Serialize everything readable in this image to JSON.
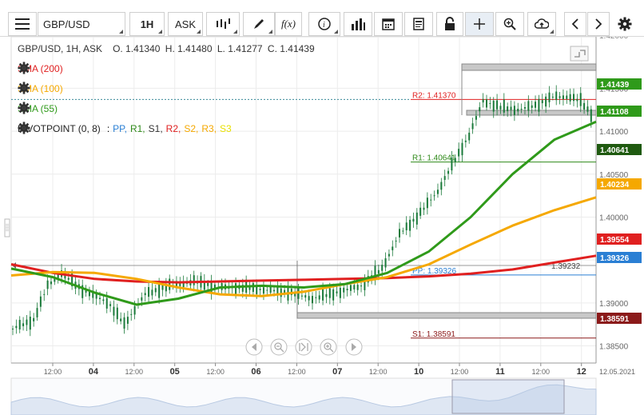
{
  "toolbar": {
    "symbol": "GBP/USD",
    "timeframe": "1H",
    "price_type": "ASK",
    "fx_label": "f(x)"
  },
  "header": {
    "instrument": "GBP/USD, 1H, ASK",
    "open": "O. 1.41340",
    "high": "H. 1.41480",
    "low": "L. 1.41277",
    "close": "C. 1.41439"
  },
  "indicators": [
    {
      "label": "SMA (200)",
      "color": "#e02020"
    },
    {
      "label": "SMA (100)",
      "color": "#f5a800"
    },
    {
      "label": "SMA (55)",
      "color": "#2f9a1a"
    }
  ],
  "pivot": {
    "label": "PIVOTPOINT (0, 8)",
    "sep": ":",
    "items": [
      {
        "label": "PP,",
        "color": "#2a7fd4"
      },
      {
        "label": "R1,",
        "color": "#2f8a1a"
      },
      {
        "label": "S1,",
        "color": "#333333"
      },
      {
        "label": "R2,",
        "color": "#e02020"
      },
      {
        "label": "S2,",
        "color": "#f5a800"
      },
      {
        "label": "R3,",
        "color": "#f5a800"
      },
      {
        "label": "S3",
        "color": "#e8e000"
      }
    ]
  },
  "price_axis": {
    "ticks": [
      "1.41500",
      "1.41000",
      "1.40500",
      "1.40000",
      "1.39500",
      "1.39000",
      "1.38500"
    ],
    "top_partial": "1.42000",
    "badges": [
      {
        "value": "1.41439",
        "color": "#2f9a1a"
      },
      {
        "value": "1.41108",
        "color": "#2f9a1a"
      },
      {
        "value": "1.40641",
        "color": "#1f5a10"
      },
      {
        "value": "1.40234",
        "color": "#f5a800"
      },
      {
        "value": "1.39554",
        "color": "#e02020"
      },
      {
        "value": "1.39326",
        "color": "#2a7fd4"
      },
      {
        "value": "1.38591",
        "color": "#8b1a1a"
      }
    ],
    "cursor_value": "1.39232"
  },
  "pivot_levels": [
    {
      "label": "R2: 1.41370",
      "value": 1.4137,
      "color": "#e02020"
    },
    {
      "label": "R1: 1.40641",
      "value": 1.40641,
      "color": "#2f8a1a"
    },
    {
      "label": "PP: 1.39326",
      "value": 1.39326,
      "color": "#2a7fd4"
    },
    {
      "label": "S1: 1.38591",
      "value": 1.38591,
      "color": "#8b1a1a"
    }
  ],
  "time_axis": {
    "labels": [
      "12:00",
      "04",
      "12:00",
      "05",
      "12:00",
      "06",
      "12:00",
      "07",
      "12:00",
      "10",
      "12:00",
      "11",
      "12:00",
      "12"
    ],
    "date_stamp": "12.05.2021"
  },
  "colors": {
    "grid": "#ececec",
    "candle": "#1a7a3a",
    "sma200": "#e02020",
    "sma100": "#f5a800",
    "sma55": "#2f9a1a"
  },
  "chart_data": {
    "type": "line",
    "ylim": [
      1.383,
      1.421
    ],
    "series": [
      {
        "name": "SMA (200)",
        "values": [
          1.3945,
          1.3935,
          1.3928,
          1.3925,
          1.3924,
          1.3925,
          1.3926,
          1.3927,
          1.3928,
          1.3929,
          1.3931,
          1.3934,
          1.3939,
          1.3947,
          1.3955
        ]
      },
      {
        "name": "SMA (100)",
        "values": [
          1.3932,
          1.3936,
          1.3935,
          1.3928,
          1.3918,
          1.391,
          1.3908,
          1.3913,
          1.3922,
          1.393,
          1.3945,
          1.3968,
          1.399,
          1.4008,
          1.4023
        ]
      },
      {
        "name": "SMA (55)",
        "values": [
          1.394,
          1.393,
          1.3912,
          1.3898,
          1.3905,
          1.3918,
          1.392,
          1.3918,
          1.3922,
          1.3935,
          1.396,
          1.4,
          1.405,
          1.409,
          1.4111
        ]
      }
    ]
  }
}
